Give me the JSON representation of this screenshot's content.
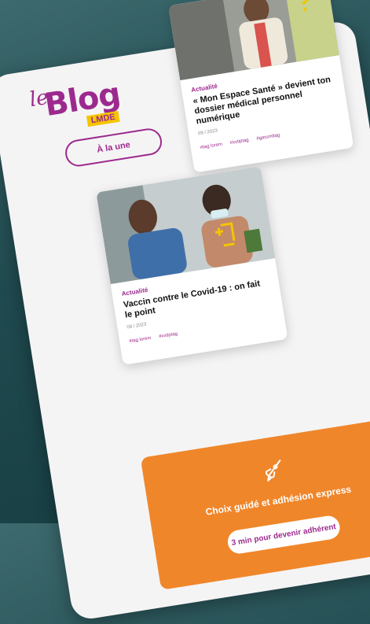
{
  "logo": {
    "prefix": "le",
    "word": "Blog",
    "badge": "LMDE"
  },
  "header": {
    "une_button": "À la une"
  },
  "articles": [
    {
      "category": "Actualité",
      "title": "« Mon Espace Santé » devient ton dossier médical personnel numérique",
      "date": "09 / 2023",
      "tags": [
        "#tag lorem",
        "#xxtiptag",
        "#garumltag"
      ]
    },
    {
      "category": "Actualité",
      "title": "Vaccin contre le Covid-19 : on fait le point",
      "date": "09 / 2023",
      "tags": [
        "#tag lorem",
        "#xxtiptag"
      ]
    }
  ],
  "cta": {
    "icon": "rocket-icon",
    "title": "Choix guidé et adhésion express",
    "button": "3 min pour devenir adhérent"
  },
  "colors": {
    "brand": "#9c2a8e",
    "accent": "#f0862a",
    "badge": "#f5c400"
  }
}
